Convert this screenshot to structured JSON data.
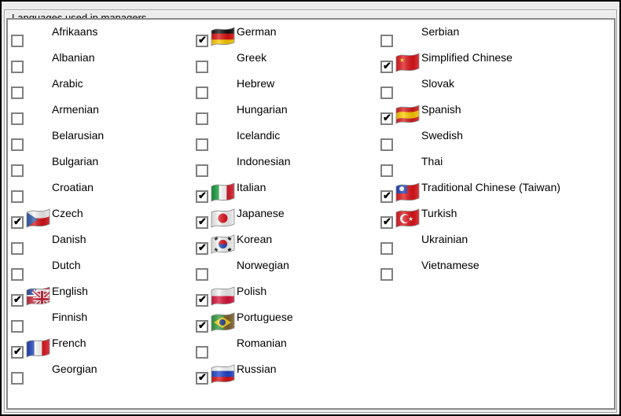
{
  "group": {
    "title": "Languages used in managers"
  },
  "columns": [
    [
      {
        "name": "Afrikaans",
        "checked": false,
        "flag": ""
      },
      {
        "name": "Albanian",
        "checked": false,
        "flag": ""
      },
      {
        "name": "Arabic",
        "checked": false,
        "flag": ""
      },
      {
        "name": "Armenian",
        "checked": false,
        "flag": ""
      },
      {
        "name": "Belarusian",
        "checked": false,
        "flag": ""
      },
      {
        "name": "Bulgarian",
        "checked": false,
        "flag": ""
      },
      {
        "name": "Croatian",
        "checked": false,
        "flag": ""
      },
      {
        "name": "Czech",
        "checked": true,
        "flag": "czech-flag"
      },
      {
        "name": "Danish",
        "checked": false,
        "flag": ""
      },
      {
        "name": "Dutch",
        "checked": false,
        "flag": ""
      },
      {
        "name": "English",
        "checked": true,
        "flag": "english-flag"
      },
      {
        "name": "Finnish",
        "checked": false,
        "flag": ""
      },
      {
        "name": "French",
        "checked": true,
        "flag": "french-flag"
      },
      {
        "name": "Georgian",
        "checked": false,
        "flag": ""
      }
    ],
    [
      {
        "name": "German",
        "checked": true,
        "flag": "german-flag"
      },
      {
        "name": "Greek",
        "checked": false,
        "flag": ""
      },
      {
        "name": "Hebrew",
        "checked": false,
        "flag": ""
      },
      {
        "name": "Hungarian",
        "checked": false,
        "flag": ""
      },
      {
        "name": "Icelandic",
        "checked": false,
        "flag": ""
      },
      {
        "name": "Indonesian",
        "checked": false,
        "flag": ""
      },
      {
        "name": "Italian",
        "checked": true,
        "flag": "italian-flag"
      },
      {
        "name": "Japanese",
        "checked": true,
        "flag": "japanese-flag"
      },
      {
        "name": "Korean",
        "checked": true,
        "flag": "korean-flag"
      },
      {
        "name": "Norwegian",
        "checked": false,
        "flag": ""
      },
      {
        "name": "Polish",
        "checked": true,
        "flag": "polish-flag"
      },
      {
        "name": "Portuguese",
        "checked": true,
        "flag": "brazilian-flag"
      },
      {
        "name": "Romanian",
        "checked": false,
        "flag": ""
      },
      {
        "name": "Russian",
        "checked": true,
        "flag": "russian-flag"
      }
    ],
    [
      {
        "name": "Serbian",
        "checked": false,
        "flag": ""
      },
      {
        "name": "Simplified Chinese",
        "checked": true,
        "flag": "chinese-flag"
      },
      {
        "name": "Slovak",
        "checked": false,
        "flag": ""
      },
      {
        "name": "Spanish",
        "checked": true,
        "flag": "spanish-flag"
      },
      {
        "name": "Swedish",
        "checked": false,
        "flag": ""
      },
      {
        "name": "Thai",
        "checked": false,
        "flag": ""
      },
      {
        "name": "Traditional Chinese (Taiwan)",
        "checked": true,
        "flag": "taiwan-flag"
      },
      {
        "name": "Turkish",
        "checked": true,
        "flag": "turkish-flag"
      },
      {
        "name": "Ukrainian",
        "checked": false,
        "flag": ""
      },
      {
        "name": "Vietnamese",
        "checked": false,
        "flag": ""
      }
    ]
  ],
  "icons": {
    "check": "✔"
  }
}
